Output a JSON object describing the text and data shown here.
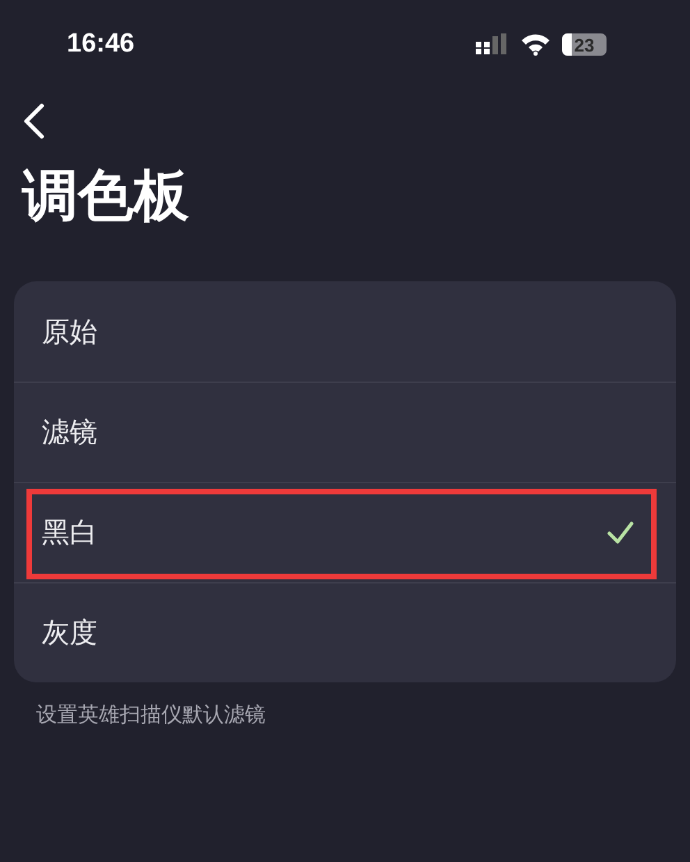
{
  "status_bar": {
    "time": "16:46",
    "battery": "23"
  },
  "title": "调色板",
  "options": [
    {
      "label": "原始",
      "selected": false,
      "highlighted": false
    },
    {
      "label": "滤镜",
      "selected": false,
      "highlighted": false
    },
    {
      "label": "黑白",
      "selected": true,
      "highlighted": true
    },
    {
      "label": "灰度",
      "selected": false,
      "highlighted": false
    }
  ],
  "footnote": "设置英雄扫描仪默认滤镜"
}
